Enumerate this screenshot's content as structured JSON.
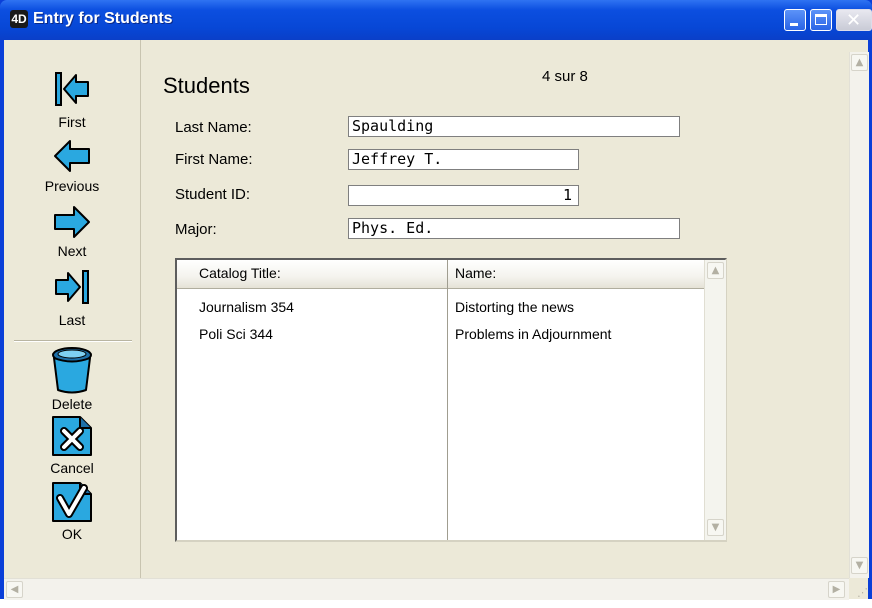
{
  "window": {
    "title": "Entry for Students",
    "app_icon": "4D"
  },
  "nav": {
    "first": "First",
    "previous": "Previous",
    "next": "Next",
    "last": "Last",
    "delete": "Delete",
    "cancel": "Cancel",
    "ok": "OK"
  },
  "form": {
    "title": "Students",
    "record_count": "4 sur 8",
    "fields": {
      "last_name_label": "Last Name:",
      "last_name_value": "Spaulding",
      "first_name_label": "First Name:",
      "first_name_value": "Jeffrey T.",
      "student_id_label": "Student ID:",
      "student_id_value": "1",
      "major_label": "Major:",
      "major_value": "Phys. Ed."
    }
  },
  "list": {
    "columns": [
      "Catalog Title:",
      "Name:"
    ],
    "rows": [
      [
        "Journalism 354",
        "Distorting the news"
      ],
      [
        "Poli Sci 344",
        "Problems in Adjournment"
      ]
    ]
  },
  "colors": {
    "titlebar": "#0747d6",
    "window_bg": "#ece9d8",
    "icon_blue": "#2aa8e0"
  }
}
